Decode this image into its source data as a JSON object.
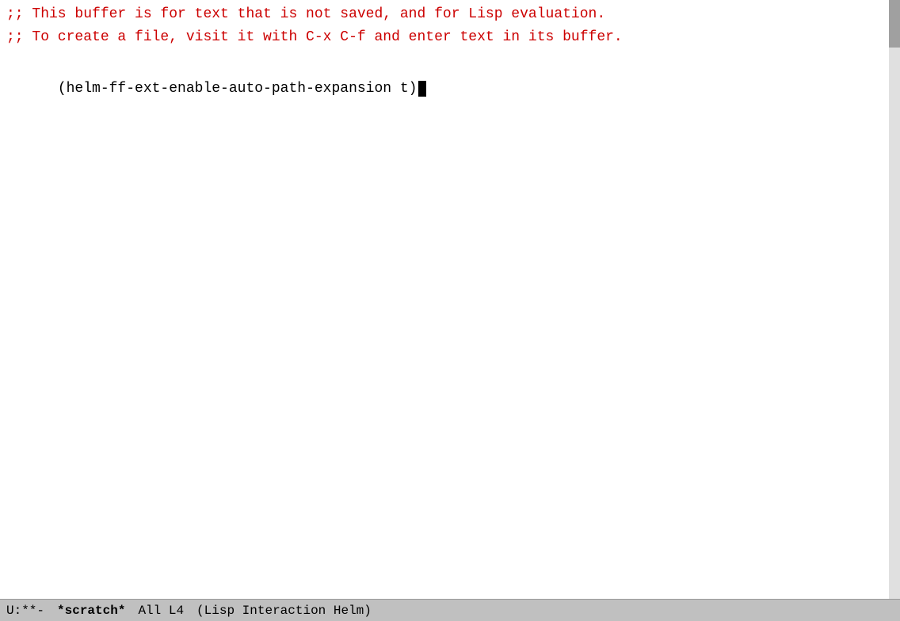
{
  "editor": {
    "background": "#ffffff",
    "comment_line1": ";; This buffer is for text that is not saved, and for Lisp evaluation.",
    "comment_line2": ";; To create a file, visit it with C-x C-f and enter text in its buffer.",
    "code_line": "(helm-ff-ext-enable-auto-path-expansion t)"
  },
  "status_bar": {
    "encoding": "U:**-",
    "buffer_name": "*scratch*",
    "position": "All L4",
    "mode": "(Lisp Interaction Helm)",
    "background": "#c0c0c0"
  },
  "scrollbar": {
    "label": "scrollbar"
  }
}
